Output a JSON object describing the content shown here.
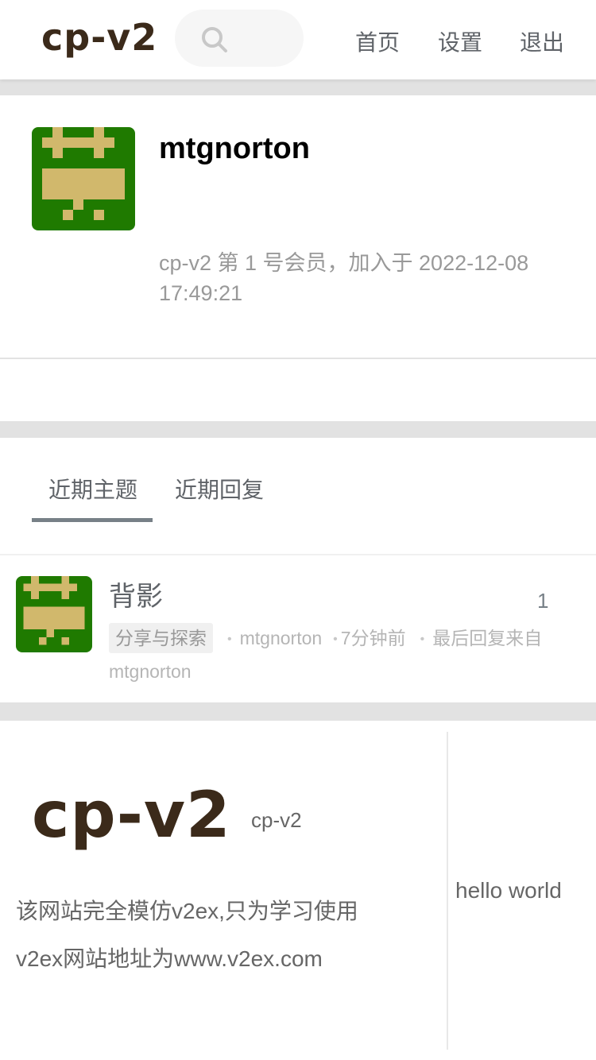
{
  "header": {
    "logo": "cp-v2",
    "nav": [
      "首页",
      "设置",
      "退出"
    ]
  },
  "profile": {
    "username": "mtgnorton",
    "member_info": "cp-v2 第 1 号会员，加入于 2022-12-08 17:49:21"
  },
  "tabs": [
    "近期主题",
    "近期回复"
  ],
  "topic": {
    "title": "背影",
    "reply_count": "1",
    "node": "分享与探索",
    "author": "mtgnorton",
    "time": "7分钟前",
    "last_reply": "最后回复来自 mtgnorton"
  },
  "footer": {
    "logo": "cp-v2",
    "subtitle": "cp-v2",
    "line1": "该网站完全模仿v2ex,只为学习使用",
    "line2": "v2ex网站地址为www.v2ex.com",
    "side_text": "hello world"
  },
  "colors": {
    "avatar_bg": "#1f7a00",
    "avatar_fg": "#d1b86c",
    "logo": "#3b2a1a"
  }
}
